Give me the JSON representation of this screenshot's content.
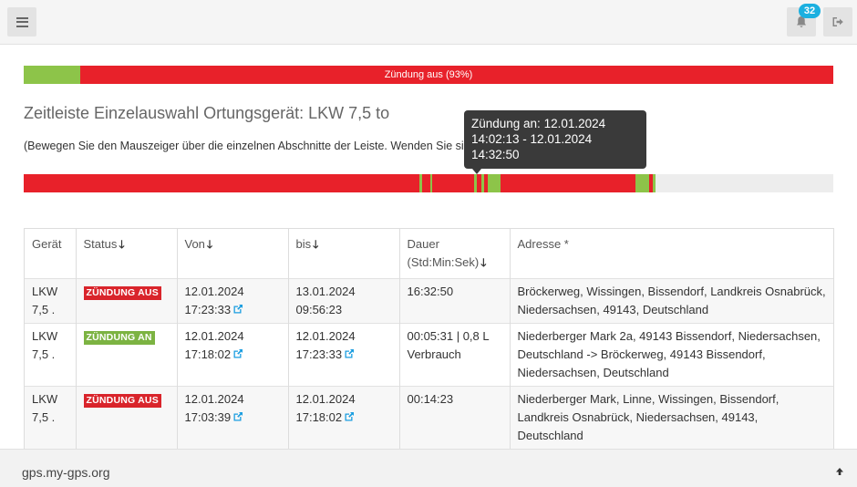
{
  "header": {
    "menu_icon": "hamburger-icon",
    "notifications_icon": "bell-icon",
    "notifications_count": "32",
    "logout_icon": "sign-out-icon"
  },
  "summary_bar": {
    "label": "Zündung aus (93%)",
    "on_fraction": 0.07,
    "color_on": "#8dc449",
    "color_off": "#e8212a"
  },
  "title": "Zeitleiste Einzelauswahl Ortungsgerät: LKW 7,5 to",
  "hint": "(Bewegen Sie den Mauszeiger über die einzelnen Abschnitte der Leiste. Wenden Sie sich an. Fragen an.)",
  "timeline": {
    "colors": {
      "aus": "#e8212a",
      "an": "#8dc449",
      "empty": "#ededed"
    },
    "segments": [
      {
        "state": "aus",
        "start": 0.0,
        "end": 0.489
      },
      {
        "state": "an",
        "start": 0.489,
        "end": 0.492
      },
      {
        "state": "aus",
        "start": 0.492,
        "end": 0.502
      },
      {
        "state": "an",
        "start": 0.502,
        "end": 0.504
      },
      {
        "state": "aus",
        "start": 0.504,
        "end": 0.556
      },
      {
        "state": "an",
        "start": 0.556,
        "end": 0.56
      },
      {
        "state": "aus",
        "start": 0.56,
        "end": 0.565
      },
      {
        "state": "an",
        "start": 0.565,
        "end": 0.569
      },
      {
        "state": "aus",
        "start": 0.569,
        "end": 0.573
      },
      {
        "state": "an",
        "start": 0.573,
        "end": 0.589
      },
      {
        "state": "aus",
        "start": 0.589,
        "end": 0.756
      },
      {
        "state": "an",
        "start": 0.756,
        "end": 0.773
      },
      {
        "state": "aus",
        "start": 0.773,
        "end": 0.777
      },
      {
        "state": "an",
        "start": 0.777,
        "end": 0.78
      }
    ]
  },
  "tooltip": {
    "line1": "Zündung an: 12.01.2024",
    "line2": "14:02:13 - 12.01.2024",
    "line3": "14:32:50"
  },
  "table": {
    "headers": {
      "device": "Gerät",
      "status": "Status",
      "from": "Von",
      "to": "bis",
      "duration": "Dauer",
      "duration_unit": "(Std:Min:Sek)",
      "address": "Adresse *"
    },
    "rows": [
      {
        "device_line1": "LKW",
        "device_line2": "7,5 .",
        "status": "ZÜNDUNG AUS",
        "status_type": "aus",
        "from_date": "12.01.2024",
        "from_time": "17:23:33",
        "to_date": "13.01.2024",
        "to_time": "09:56:23",
        "duration": "16:32:50",
        "address": "Bröckerweg, Wissingen, Bissendorf, Landkreis Osnabrück, Niedersachsen, 49143, Deutschland"
      },
      {
        "device_line1": "LKW",
        "device_line2": "7,5 .",
        "status": "ZÜNDUNG AN",
        "status_type": "an",
        "from_date": "12.01.2024",
        "from_time": "17:18:02",
        "to_date": "12.01.2024",
        "to_time": "17:23:33",
        "duration": "00:05:31 | 0,8 L Verbrauch",
        "address": "Niederberger Mark 2a, 49143 Bissendorf, Niedersachsen, Deutschland -> Bröckerweg, 49143 Bissendorf, Niedersachsen, Deutschland"
      },
      {
        "device_line1": "LKW",
        "device_line2": "7,5 .",
        "status": "ZÜNDUNG AUS",
        "status_type": "aus",
        "from_date": "12.01.2024",
        "from_time": "17:03:39",
        "to_date": "12.01.2024",
        "to_time": "17:18:02",
        "duration": "00:14:23",
        "address": "Niederberger Mark, Linne, Wissingen, Bissendorf, Landkreis Osnabrück, Niedersachsen, 49143, Deutschland"
      }
    ]
  },
  "footer": {
    "text": "gps.my-gps.org",
    "scroll_top_icon": "arrow-up-icon"
  }
}
